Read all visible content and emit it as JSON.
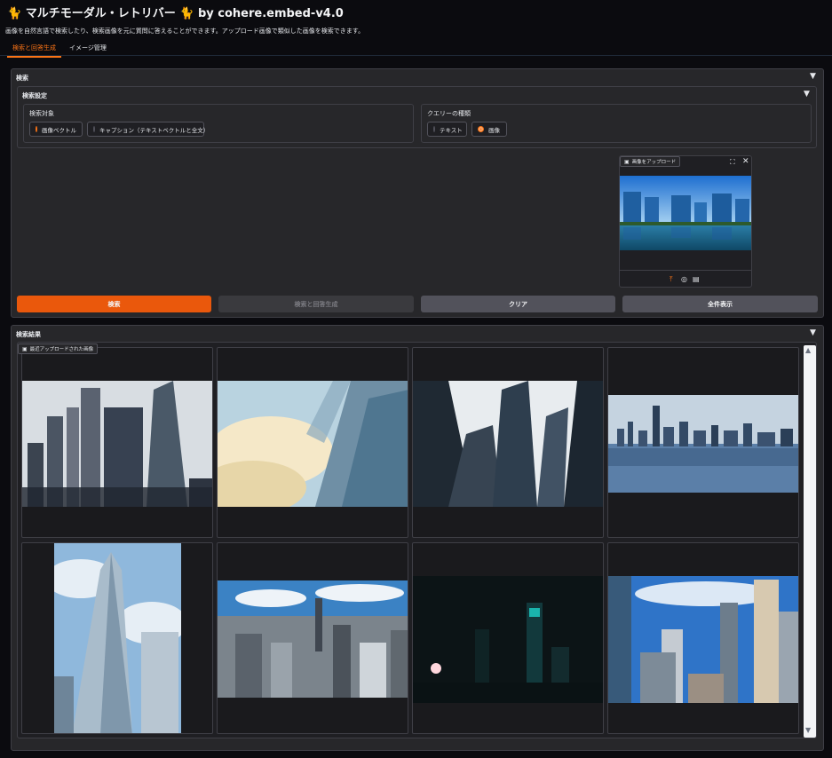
{
  "header": {
    "title": "🐈 マルチモーダル・レトリバー 🐈 by cohere.embed-v4.0",
    "subtitle": "画像を自然言語で検索したり、検索画像を元に質問に答えることができます。アップロード画像で類似した画像を検索できます。"
  },
  "tabs": [
    {
      "label": "検索と回答生成",
      "active": true
    },
    {
      "label": "イメージ管理",
      "active": false
    }
  ],
  "search_panel": {
    "title": "検索",
    "settings": {
      "title": "検索設定",
      "target": {
        "label": "検索対象",
        "options": [
          "画像ベクトル",
          "キャプション（テキストベクトルと全文）"
        ],
        "selected": "画像ベクトル"
      },
      "query_type": {
        "label": "クエリーの種類",
        "options": [
          "テキスト",
          "画像"
        ],
        "selected": "画像"
      }
    },
    "upload": {
      "label": "画像をアップロード"
    },
    "buttons": {
      "search": "検索",
      "search_answer": "検索と回答生成",
      "clear": "クリア",
      "show_all": "全件表示"
    }
  },
  "results_panel": {
    "title": "検索結果",
    "gallery_label": "最近アップロードされた画像"
  },
  "colors": {
    "accent": "#ea580c",
    "background": "#0b0b0f",
    "panel": "#27272a"
  },
  "icons": [
    "upload-icon",
    "webcam-icon",
    "clipboard-icon",
    "fullscreen-icon",
    "close-icon",
    "image-icon",
    "caret-down-icon"
  ]
}
